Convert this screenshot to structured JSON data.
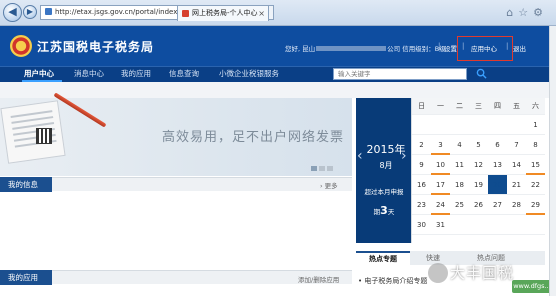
{
  "browser": {
    "address": "http://etax.jsgs.gov.cn/portal/index.do",
    "tab_title": "网上税务局-个人中心",
    "tab_close": "×",
    "back_glyph": "◀",
    "forward_glyph": "▶",
    "tools_glyph": "▾ ⟳",
    "right_icons": "⌂☆⚙"
  },
  "header": {
    "site_title": "江苏国税电子税务局",
    "welcome_prefix": "您好, 昆山",
    "welcome_suffix": "公司 信用级别：B级",
    "links": [
      "设置",
      "应用中心",
      "退出"
    ],
    "separators": [
      "|",
      "|",
      "|"
    ]
  },
  "nav": {
    "items": [
      "用户中心",
      "消息中心",
      "我的应用",
      "信息查询",
      "小微企业税银服务"
    ],
    "search_placeholder": "输入关键字"
  },
  "banner": {
    "slogan": "高效易用，足不出户网络发票"
  },
  "panels": {
    "my_info": {
      "title": "我的信息",
      "more": "› 更多"
    },
    "my_apps": {
      "title": "我的应用",
      "action": "添加/删除应用"
    }
  },
  "calendar": {
    "year": "2015年",
    "month": "8月",
    "note": "超过本月申报",
    "deadline_prefix": "期",
    "deadline_days": "3",
    "deadline_suffix": "天",
    "prev": "‹",
    "next": "›",
    "weekdays": [
      "日",
      "一",
      "二",
      "三",
      "四",
      "五",
      "六"
    ],
    "rows": [
      [
        "",
        "",
        "",
        "",
        "",
        "",
        "1"
      ],
      [
        "2",
        "3",
        "4",
        "5",
        "6",
        "7",
        "8"
      ],
      [
        "9",
        "10",
        "11",
        "12",
        "13",
        "14",
        "15"
      ],
      [
        "16",
        "17",
        "18",
        "19",
        "20",
        "21",
        "22"
      ],
      [
        "23",
        "24",
        "25",
        "26",
        "27",
        "28",
        "29"
      ],
      [
        "30",
        "31",
        "",
        "",
        "",
        "",
        ""
      ]
    ]
  },
  "hot": {
    "tabs": [
      "热点专题",
      "快速",
      "热点问题"
    ],
    "items": [
      "• 电子税务局介绍专题"
    ]
  },
  "watermark": {
    "text": "大丰国税",
    "badge": "www.dfgs..."
  }
}
